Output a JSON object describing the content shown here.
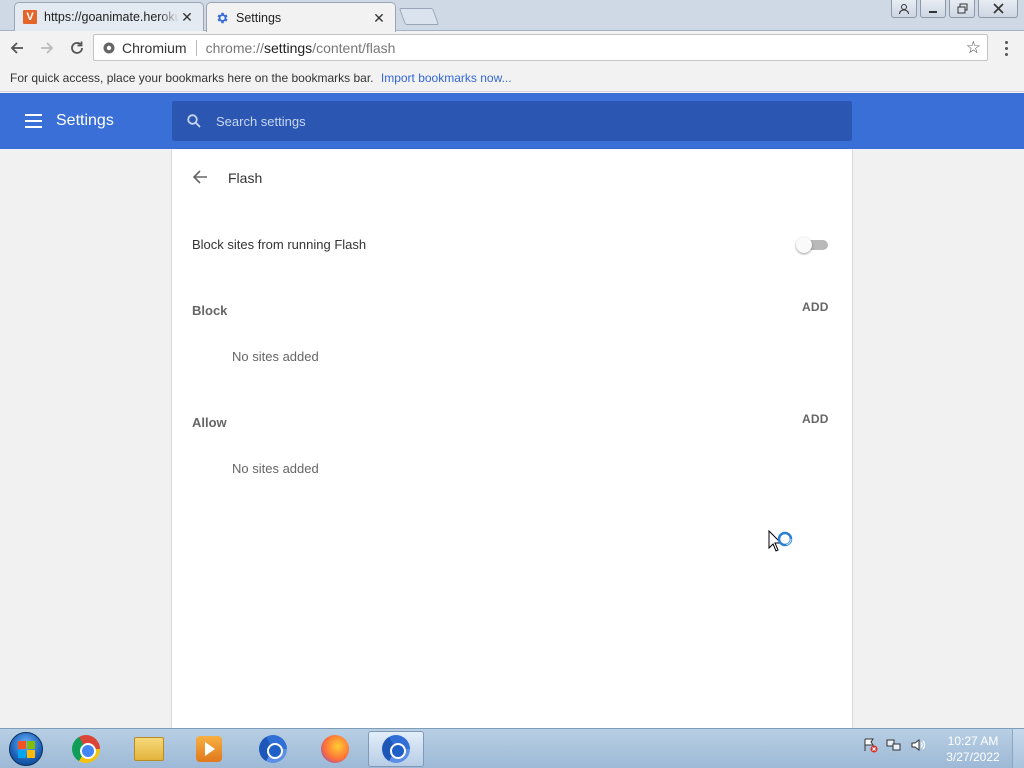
{
  "browser": {
    "tabs": [
      {
        "title": "https://goanimate.herokuapp.com",
        "icon": "goanimate-favicon-icon",
        "active": false
      },
      {
        "title": "Settings",
        "icon": "gear-icon",
        "active": true
      }
    ],
    "omnibox": {
      "site_label": "Chromium",
      "url_prefix": "chrome://",
      "url_host": "settings",
      "url_path": "/content/flash"
    },
    "bookmarks_bar": {
      "hint": "For quick access, place your bookmarks here on the bookmarks bar.",
      "import_link": "Import bookmarks now..."
    }
  },
  "settings": {
    "header_title": "Settings",
    "search_placeholder": "Search settings",
    "accent_color": "#3a6fd8",
    "page": {
      "title": "Flash",
      "toggle_label": "Block sites from running Flash",
      "toggle_on": false,
      "sections": [
        {
          "label": "Block",
          "add_label": "ADD",
          "empty_text": "No sites added"
        },
        {
          "label": "Allow",
          "add_label": "ADD",
          "empty_text": "No sites added"
        }
      ]
    }
  },
  "taskbar": {
    "apps": [
      "chrome-icon",
      "file-explorer-icon",
      "media-player-icon",
      "chromium-icon",
      "firefox-icon",
      "chromium-icon"
    ],
    "clock_time": "10:27 AM",
    "clock_date": "3/27/2022"
  }
}
